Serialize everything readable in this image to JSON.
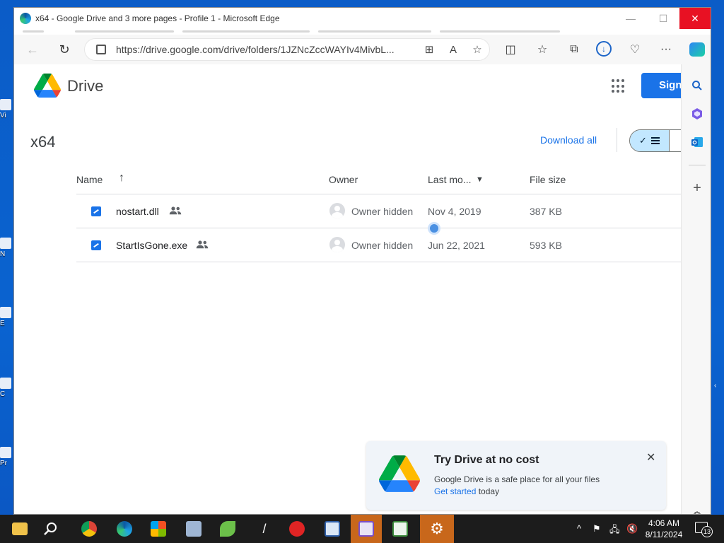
{
  "window": {
    "title": "x64 - Google Drive and 3 more pages - Profile 1 - Microsoft Edge",
    "minimize": "—",
    "maximize": "☐",
    "close": "✕"
  },
  "address_bar": {
    "url": "https://drive.google.com/drive/folders/1JZNcZccWAYIv4MivbL..."
  },
  "drive": {
    "brand": "Drive",
    "sign_in": "Sign",
    "folder_title": "x64",
    "download_all": "Download all",
    "columns": {
      "name": "Name",
      "name_sort": "↑",
      "owner": "Owner",
      "last_modified": "Last mo...",
      "last_modified_sort": "▼",
      "file_size": "File size"
    },
    "files": [
      {
        "name": "nostart.dll",
        "owner": "Owner hidden",
        "modified": "Nov 4, 2019",
        "size": "387 KB"
      },
      {
        "name": "StartIsGone.exe",
        "owner": "Owner hidden",
        "modified": "Jun 22, 2021",
        "size": "593 KB"
      }
    ],
    "promo": {
      "title": "Try Drive at no cost",
      "text": "Google Drive is a safe place for all your files",
      "link": "Get started",
      "suffix": " today",
      "close": "✕"
    }
  },
  "desktop": {
    "icon_labels": [
      "Vi",
      "N",
      "E",
      "C",
      "Pr"
    ]
  },
  "taskbar": {
    "time": "4:06 AM",
    "date": "8/11/2024",
    "notification_count": "13"
  },
  "colors": {
    "accent": "#1a73e8",
    "taskbar_active": "#c8671b",
    "close_red": "#e81123"
  }
}
